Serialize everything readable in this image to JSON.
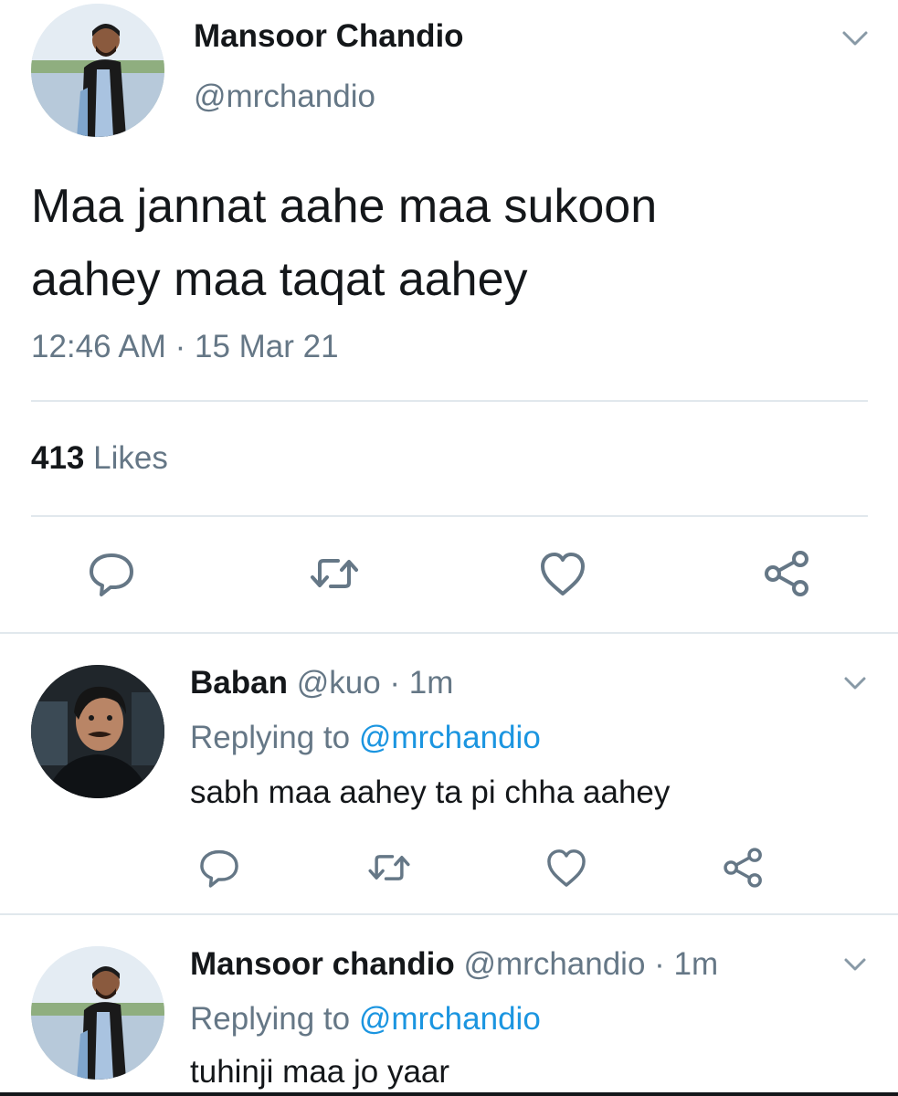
{
  "main_tweet": {
    "author_name": "Mansoor Chandio",
    "author_handle": "@mrchandio",
    "text": "Maa jannat aahe maa sukoon\naahey maa taqat aahey",
    "timestamp": "12:46 AM · 15 Mar 21",
    "likes_count": "413",
    "likes_label": "Likes",
    "actions": [
      "reply-icon",
      "retweet-icon",
      "like-icon",
      "share-icon"
    ]
  },
  "replies": [
    {
      "author_name": "Baban",
      "author_handle": "@kuo",
      "time": "· 1m",
      "replying_prefix": "Replying to",
      "replying_handle": "@mrchandio",
      "text": "sabh maa aahey ta pi chha aahey"
    },
    {
      "author_name": "Mansoor chandio",
      "author_handle": "@mrchandio",
      "time": "· 1m",
      "replying_prefix": "Replying to",
      "replying_handle": "@mrchandio",
      "text": "tuhinji maa jo yaar"
    }
  ],
  "colors": {
    "text": "#14171a",
    "muted": "#657786",
    "link": "#1b95e0",
    "divider": "#e1e8ed"
  }
}
